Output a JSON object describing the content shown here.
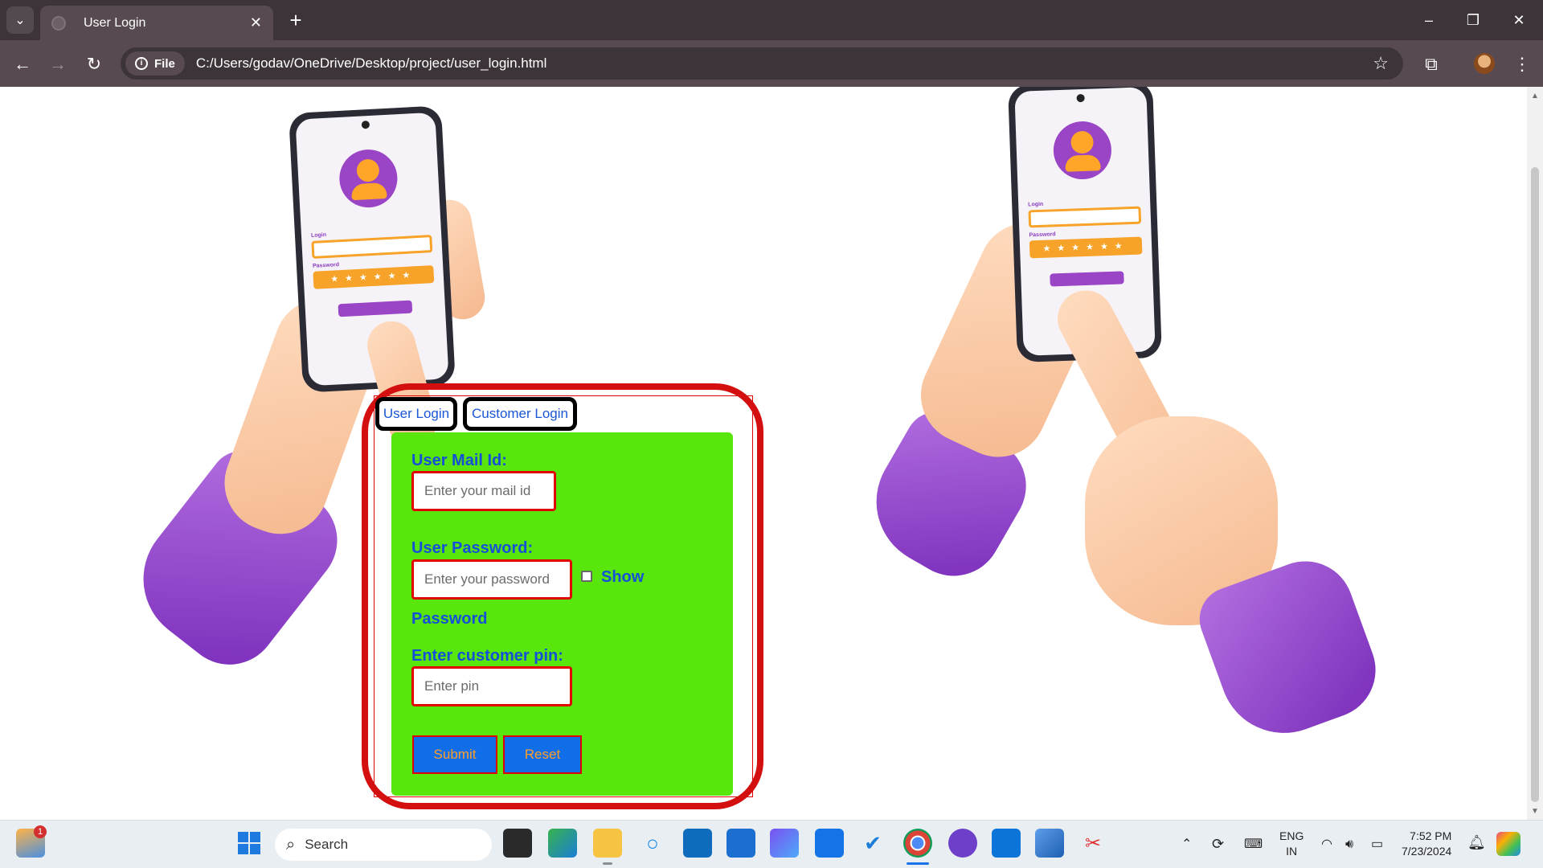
{
  "browser": {
    "tab_title": "User Login",
    "file_chip": "File",
    "url": "C:/Users/godav/OneDrive/Desktop/project/user_login.html"
  },
  "illustration": {
    "phone_login_label": "Login",
    "phone_password_label": "Password",
    "phone_stars": "★★★★★★"
  },
  "tabs": {
    "user_login": "User Login",
    "customer_login": "Customer Login"
  },
  "form": {
    "mail_label": "User Mail Id:",
    "mail_placeholder": "Enter your mail id",
    "password_label": "User Password:",
    "password_placeholder": "Enter your password",
    "show_label": "Show",
    "show_label_cont": "Password",
    "pin_label": "Enter customer pin:",
    "pin_placeholder": "Enter pin",
    "submit_label": "Submit",
    "reset_label": "Reset",
    "show_checked": false
  },
  "taskbar": {
    "search_label": "Search",
    "weather_badge": "1",
    "lang_line1": "ENG",
    "lang_line2": "IN",
    "time": "7:52 PM",
    "date": "7/23/2024"
  },
  "colors": {
    "panel_green": "#59e60c",
    "label_blue": "#1450d8",
    "frame_red": "#d40f0f",
    "button_blue": "#0f6ee8",
    "button_text_orange": "#ff9f2a"
  }
}
